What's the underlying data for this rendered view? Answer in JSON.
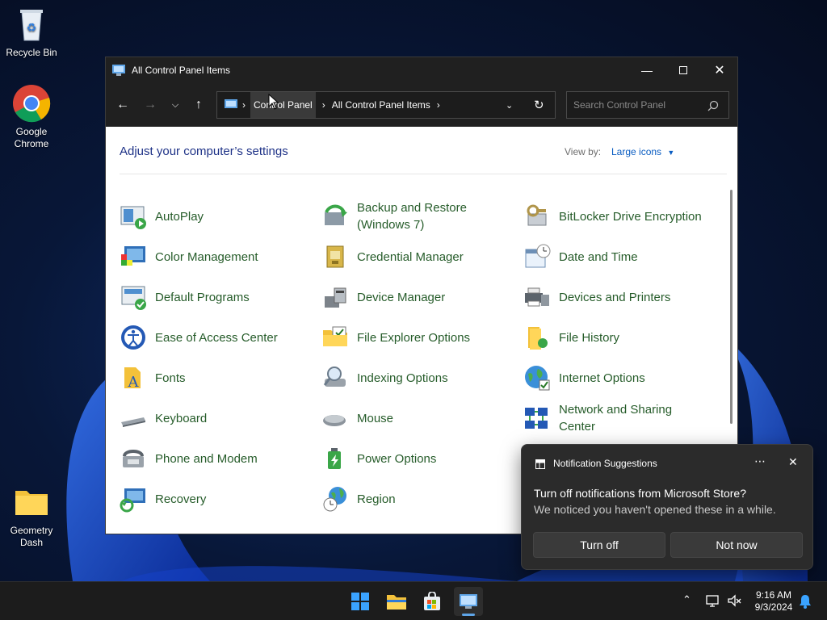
{
  "desktop": {
    "icons": [
      {
        "label": "Recycle Bin"
      },
      {
        "label": "Google\nChrome"
      },
      {
        "label": "Geometry\nDash"
      }
    ]
  },
  "window": {
    "title": "All Control Panel Items",
    "breadcrumb": [
      "Control Panel",
      "All Control Panel Items"
    ],
    "search_placeholder": "Search Control Panel",
    "heading": "Adjust your computer’s settings",
    "view_by_label": "View by:",
    "view_by_value": "Large icons",
    "items": [
      {
        "label": "AutoPlay",
        "icon": "autoplay-icon"
      },
      {
        "label": "Backup and Restore (Windows 7)",
        "icon": "backup-icon"
      },
      {
        "label": "BitLocker Drive Encryption",
        "icon": "bitlocker-icon"
      },
      {
        "label": "Color Management",
        "icon": "color-management-icon"
      },
      {
        "label": "Credential Manager",
        "icon": "credential-icon"
      },
      {
        "label": "Date and Time",
        "icon": "date-time-icon"
      },
      {
        "label": "Default Programs",
        "icon": "default-programs-icon"
      },
      {
        "label": "Device Manager",
        "icon": "device-manager-icon"
      },
      {
        "label": "Devices and Printers",
        "icon": "printer-icon"
      },
      {
        "label": "Ease of Access Center",
        "icon": "ease-of-access-icon"
      },
      {
        "label": "File Explorer Options",
        "icon": "folder-options-icon"
      },
      {
        "label": "File History",
        "icon": "file-history-icon"
      },
      {
        "label": "Fonts",
        "icon": "fonts-icon"
      },
      {
        "label": "Indexing Options",
        "icon": "indexing-icon"
      },
      {
        "label": "Internet Options",
        "icon": "globe-icon"
      },
      {
        "label": "Keyboard",
        "icon": "keyboard-icon"
      },
      {
        "label": "Mouse",
        "icon": "mouse-icon"
      },
      {
        "label": "Network and Sharing Center",
        "icon": "network-icon"
      },
      {
        "label": "Phone and Modem",
        "icon": "phone-icon"
      },
      {
        "label": "Power Options",
        "icon": "power-icon"
      },
      {
        "label": "Recovery",
        "icon": "recovery-icon"
      },
      {
        "label": "Region",
        "icon": "region-icon"
      }
    ]
  },
  "notification": {
    "app": "Notification Suggestions",
    "heading": "Turn off notifications from Microsoft Store?",
    "body": "We noticed you haven't opened these in a while.",
    "primary": "Turn off",
    "secondary": "Not now"
  },
  "taskbar": {
    "time": "9:16 AM",
    "date": "9/3/2024"
  },
  "colors": {
    "link_green": "#265c2a",
    "heading_blue": "#1e3287",
    "accent": "#0a5dc2"
  }
}
